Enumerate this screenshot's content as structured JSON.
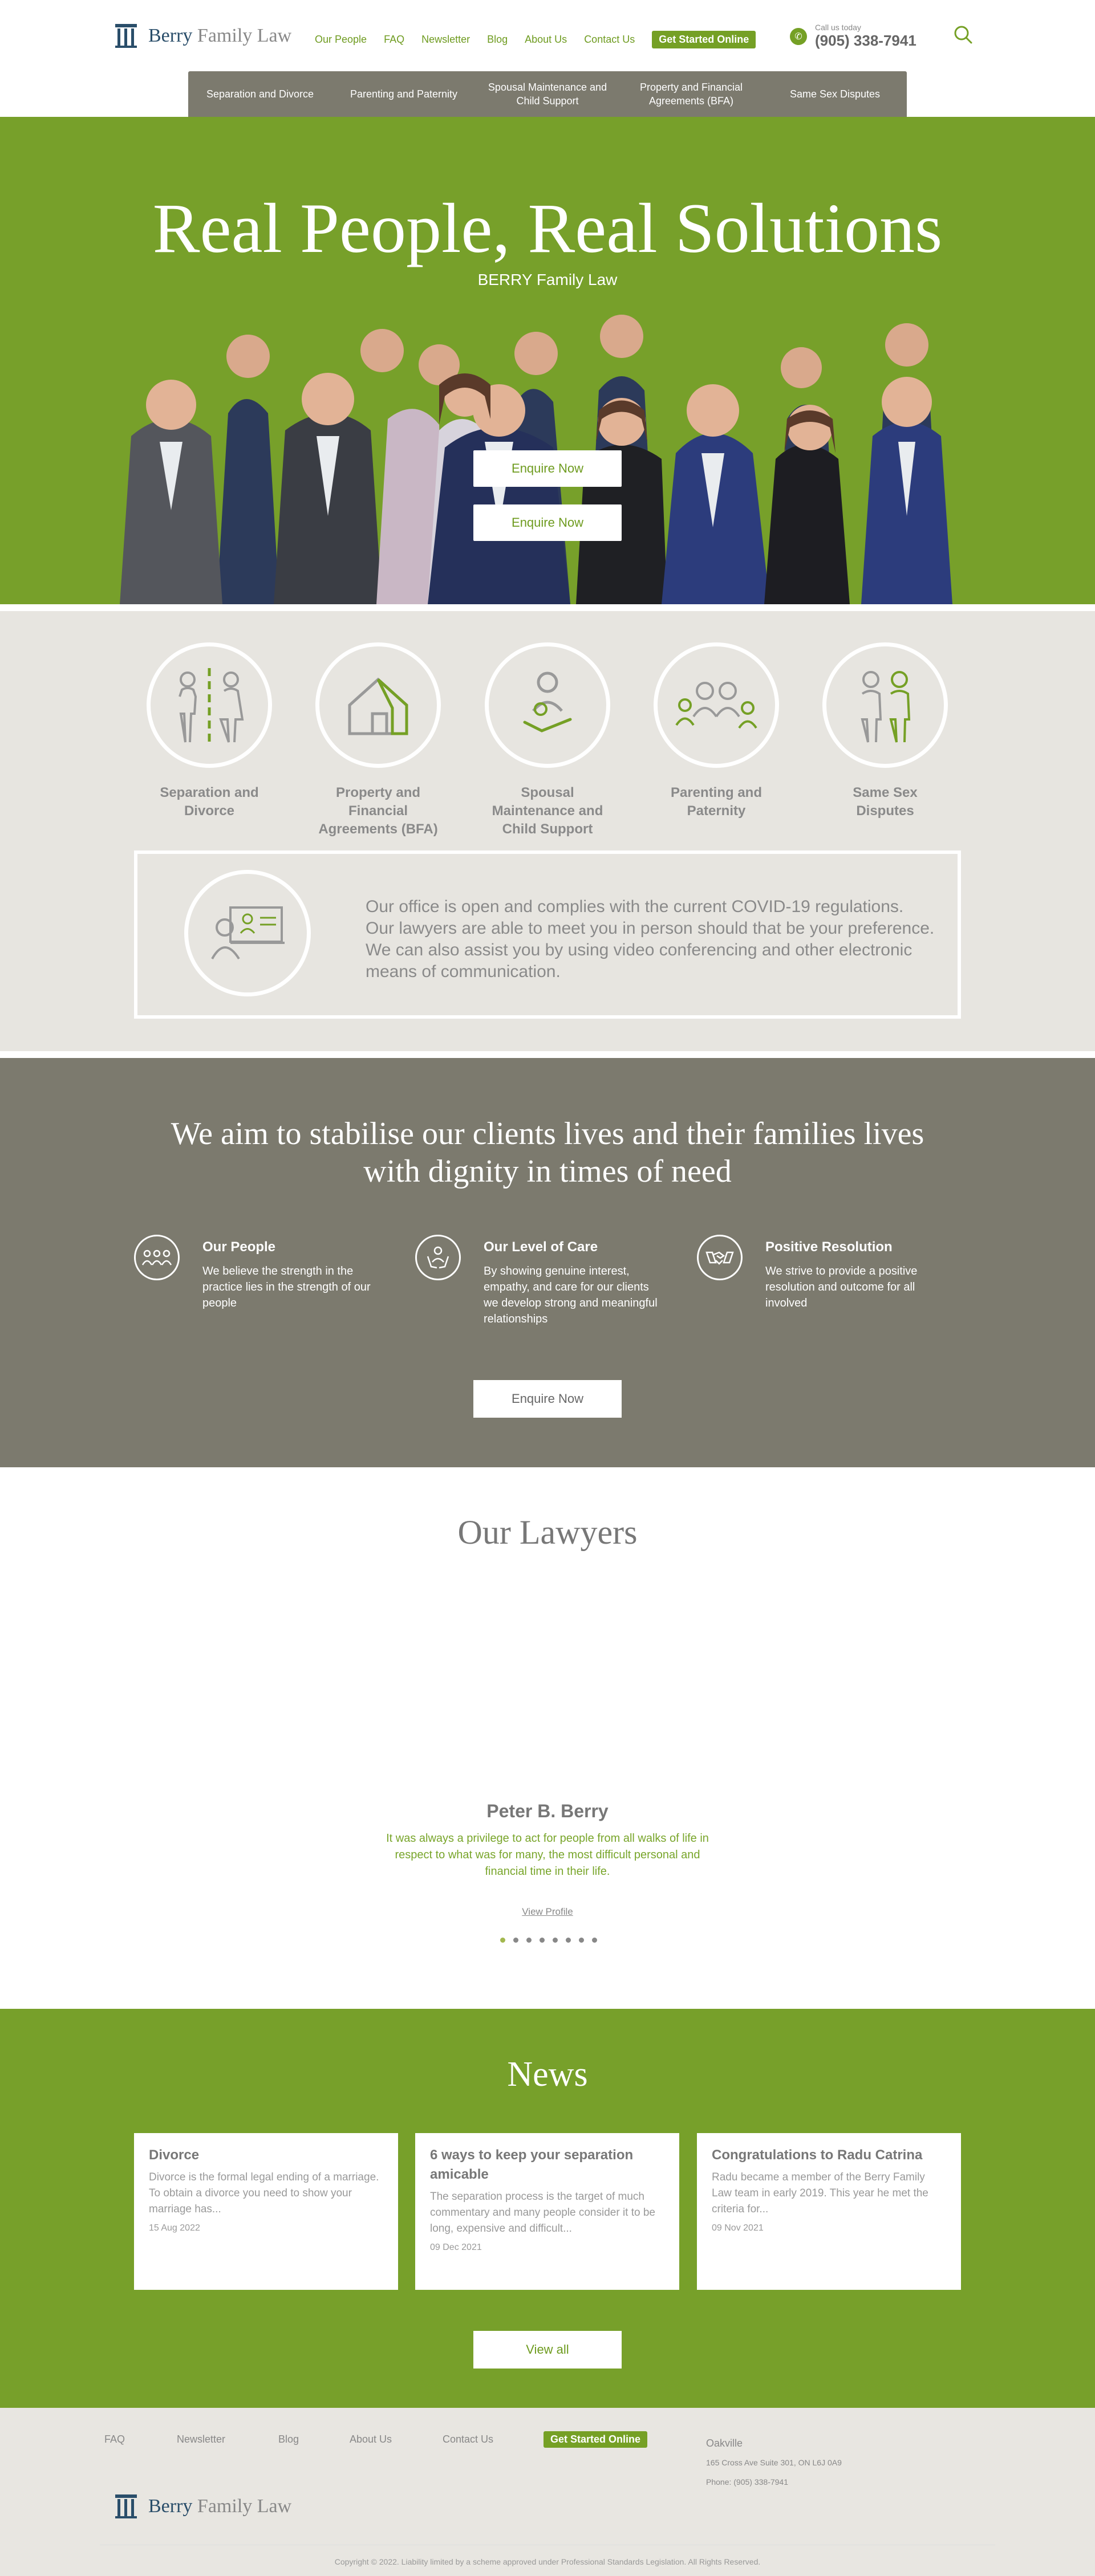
{
  "header": {
    "logo_bold": "Berry",
    "logo_rest": " Family Law",
    "nav": [
      "Our People",
      "FAQ",
      "Newsletter",
      "Blog",
      "About Us",
      "Contact Us"
    ],
    "cta": "Get Started Online",
    "call_label": "Call us today",
    "phone": "(905) 338-7941",
    "subnav": [
      "Separation and Divorce",
      "Parenting and Paternity",
      "Spousal Maintenance and Child Support",
      "Property and Financial Agreements (BFA)",
      "Same Sex Disputes"
    ]
  },
  "hero": {
    "title": "Real People, Real Solutions",
    "subtitle": "BERRY Family Law",
    "enquire_1": "Enquire Now",
    "enquire_2": "Enquire Now"
  },
  "services": {
    "items": [
      {
        "label": "Separation and Divorce",
        "icon": "separation-icon"
      },
      {
        "label": "Property and Financial Agreements (BFA)",
        "icon": "house-icon"
      },
      {
        "label": "Spousal Maintenance and Child Support",
        "icon": "support-icon"
      },
      {
        "label": "Parenting and Paternity",
        "icon": "family-icon"
      },
      {
        "label": "Same Sex Disputes",
        "icon": "couple-icon"
      }
    ],
    "covid_text": "Our office is open and complies with the current COVID-19 regulations. Our lawyers are able to meet you in person should that be your preference. We can also assist you by using video conferencing and other electronic means of communication."
  },
  "mission": {
    "title_1": "We aim to stabilise our clients lives and their families lives",
    "title_2": "with dignity in times of need",
    "pillars": [
      {
        "title": "Our People",
        "text": "We believe the strength in the practice lies in the strength of our people"
      },
      {
        "title": "Our Level of Care",
        "text": "By showing genuine interest, empathy, and care for our clients we develop strong and meaningful relationships"
      },
      {
        "title": "Positive Resolution",
        "text": "We strive to provide a positive resolution and outcome for all involved"
      }
    ],
    "enquire": "Enquire Now"
  },
  "lawyers": {
    "title": "Our Lawyers",
    "name": "Peter B. Berry",
    "quote": "It was always a privilege to act for people from all walks of life in respect to what was for many, the most difficult personal and financial time in their life.",
    "view": "View Profile",
    "dots": 8,
    "active_dot": 0
  },
  "news": {
    "title": "News",
    "cards": [
      {
        "title": "Divorce",
        "excerpt": "Divorce is the formal legal ending of a marriage. To obtain a divorce you need to show your marriage has...",
        "date": "15 Aug 2022"
      },
      {
        "title": "6 ways to keep your separation amicable",
        "excerpt": "The separation process is the target of much commentary and many people consider it to be long, expensive and difficult...",
        "date": "09 Dec 2021"
      },
      {
        "title": "Congratulations to Radu Catrina",
        "excerpt": "Radu became a member of the Berry Family Law team in early 2019. This year he met the criteria for...",
        "date": "09 Nov 2021"
      }
    ],
    "view_all": "View all"
  },
  "footer": {
    "links": [
      "FAQ",
      "Newsletter",
      "Blog",
      "About Us",
      "Contact Us"
    ],
    "cta": "Get Started Online",
    "city": "Oakville",
    "address": "165 Cross Ave Suite 301, ON L6J 0A9",
    "phone": "Phone: (905) 338-7941",
    "copyright": "Copyright © 2022. Liability limited by a scheme approved under Professional Standards Legislation. All Rights Reserved."
  },
  "colors": {
    "brand_green": "#77a02a",
    "taupe": "#7c7a6e",
    "light_grey": "#e7e5e0",
    "navy": "#2a4e6a"
  }
}
